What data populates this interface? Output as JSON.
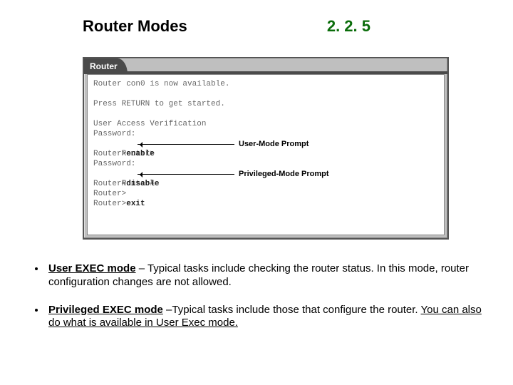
{
  "header": {
    "title": "Router Modes",
    "section": "2. 2. 5"
  },
  "window": {
    "tab": "Router",
    "lines": {
      "l0": "Router con0 is now available.",
      "l1": " ",
      "l2": "Press RETURN to get started.",
      "l3": " ",
      "l4": "User Access Verification",
      "l5": "Password:",
      "l6": "Router>",
      "l7": "Router>",
      "l7b": "enable",
      "l8": "Password:",
      "l9": "Router#",
      "l10": "Router#",
      "l10b": "disable",
      "l11": "Router>",
      "l12": "Router>",
      "l12b": "exit"
    },
    "annotations": {
      "user": "User-Mode Prompt",
      "priv": "Privileged-Mode Prompt"
    }
  },
  "bullets": {
    "b1_term": "User EXEC mode",
    "b1_rest": " – Typical tasks include checking the router status. In this mode, router configuration changes are not allowed.",
    "b2_term": "Privileged EXEC mode",
    "b2_mid": " –Typical tasks include those that configure the router. ",
    "b2_note": "You can also do what is available in User Exec mode."
  }
}
